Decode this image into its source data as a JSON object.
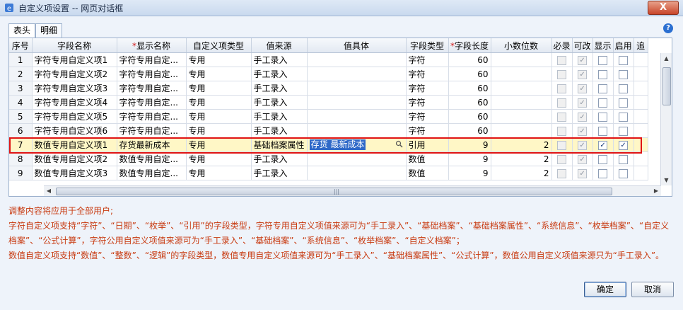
{
  "window": {
    "title": "自定义项设置 -- 网页对话框",
    "close_label": "X"
  },
  "tabs": [
    {
      "label": "表头",
      "active": true
    },
    {
      "label": "明细",
      "active": false
    }
  ],
  "help_icon": "question-icon",
  "grid": {
    "columns": [
      {
        "label": "序号",
        "required": false
      },
      {
        "label": "字段名称",
        "required": false
      },
      {
        "label": "显示名称",
        "required": true
      },
      {
        "label": "自定义项类型",
        "required": false
      },
      {
        "label": "值来源",
        "required": false
      },
      {
        "label": "值具体",
        "required": false
      },
      {
        "label": "字段类型",
        "required": false
      },
      {
        "label": "字段长度",
        "required": true
      },
      {
        "label": "小数位数",
        "required": false
      },
      {
        "label": "必录",
        "required": false
      },
      {
        "label": "可改",
        "required": false
      },
      {
        "label": "显示",
        "required": false
      },
      {
        "label": "启用",
        "required": false
      },
      {
        "label": "追",
        "required": false
      }
    ],
    "rows": [
      {
        "idx": "1",
        "field": "字符专用自定义项1",
        "display": "字符专用自定...",
        "kind": "专用",
        "source": "手工录入",
        "detail": "",
        "ftype": "字符",
        "len": "60",
        "dec": "",
        "must": false,
        "edit": true,
        "show": false,
        "enable": false
      },
      {
        "idx": "2",
        "field": "字符专用自定义项2",
        "display": "字符专用自定...",
        "kind": "专用",
        "source": "手工录入",
        "detail": "",
        "ftype": "字符",
        "len": "60",
        "dec": "",
        "must": false,
        "edit": true,
        "show": false,
        "enable": false
      },
      {
        "idx": "3",
        "field": "字符专用自定义项3",
        "display": "字符专用自定...",
        "kind": "专用",
        "source": "手工录入",
        "detail": "",
        "ftype": "字符",
        "len": "60",
        "dec": "",
        "must": false,
        "edit": true,
        "show": false,
        "enable": false
      },
      {
        "idx": "4",
        "field": "字符专用自定义项4",
        "display": "字符专用自定...",
        "kind": "专用",
        "source": "手工录入",
        "detail": "",
        "ftype": "字符",
        "len": "60",
        "dec": "",
        "must": false,
        "edit": true,
        "show": false,
        "enable": false
      },
      {
        "idx": "5",
        "field": "字符专用自定义项5",
        "display": "字符专用自定...",
        "kind": "专用",
        "source": "手工录入",
        "detail": "",
        "ftype": "字符",
        "len": "60",
        "dec": "",
        "must": false,
        "edit": true,
        "show": false,
        "enable": false
      },
      {
        "idx": "6",
        "field": "字符专用自定义项6",
        "display": "字符专用自定...",
        "kind": "专用",
        "source": "手工录入",
        "detail": "",
        "ftype": "字符",
        "len": "60",
        "dec": "",
        "must": false,
        "edit": true,
        "show": false,
        "enable": false
      },
      {
        "idx": "7",
        "field": "数值专用自定义项1",
        "display": "存货最新成本",
        "kind": "专用",
        "source": "基础档案属性",
        "detail": "存货 最新成本",
        "ftype": "引用",
        "len": "9",
        "dec": "2",
        "must": false,
        "edit": true,
        "show": true,
        "enable": true,
        "selected": true
      },
      {
        "idx": "8",
        "field": "数值专用自定义项2",
        "display": "数值专用自定...",
        "kind": "专用",
        "source": "手工录入",
        "detail": "",
        "ftype": "数值",
        "len": "9",
        "dec": "2",
        "must": false,
        "edit": true,
        "show": false,
        "enable": false
      },
      {
        "idx": "9",
        "field": "数值专用自定义项3",
        "display": "数值专用自定...",
        "kind": "专用",
        "source": "手工录入",
        "detail": "",
        "ftype": "数值",
        "len": "9",
        "dec": "2",
        "must": false,
        "edit": true,
        "show": false,
        "enable": false
      }
    ]
  },
  "notes": {
    "title": "调整内容将应用于全部用户;",
    "lines": [
      "字符自定义项支持“字符”、“日期”、“枚举”、“引用”的字段类型，字符专用自定义项值来源可为“手工录入”、“基础档案”、“基础档案属性”、“系统信息”、“枚举档案”、“自定义档案”、“公式计算”，字符公用自定义项值来源可为“手工录入”、“基础档案”、“系统信息”、“枚举档案”、“自定义档案”；",
      "数值自定义项支持“数值”、“整数”、“逻辑”的字段类型，数值专用自定义项值来源可为“手工录入”、“基础档案属性”、“公式计算”，数值公用自定义项值来源只为“手工录入”。"
    ]
  },
  "buttons": {
    "ok": "确定",
    "cancel": "取消"
  }
}
